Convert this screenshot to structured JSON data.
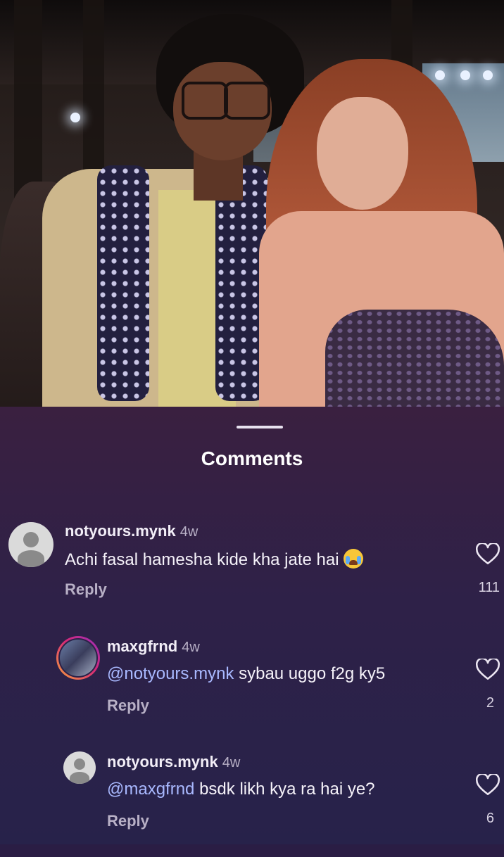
{
  "sheet": {
    "title": "Comments"
  },
  "comments": [
    {
      "username": "notyours.mynk",
      "time": "4w",
      "text": "Achi fasal hamesha kide kha jate hai",
      "emoji": "loudly-crying-face",
      "reply_label": "Reply",
      "likes": "111"
    },
    {
      "username": "maxgfrnd",
      "time": "4w",
      "mention": "@notyours.mynk",
      "text": " sybau uggo f2g ky5",
      "reply_label": "Reply",
      "likes": "2"
    },
    {
      "username": "notyours.mynk",
      "time": "4w",
      "mention": "@maxgfrnd",
      "text": " bsdk likh kya ra hai ye?",
      "reply_label": "Reply",
      "likes": "6"
    }
  ],
  "icons": {
    "like": "heart-outline-icon",
    "default_avatar": "default-avatar-icon"
  },
  "colors": {
    "sheet_top": "#3a2040",
    "sheet_bottom": "#27224a",
    "mention": "#a9b9ff",
    "secondary_text": "#b8b0c6"
  }
}
